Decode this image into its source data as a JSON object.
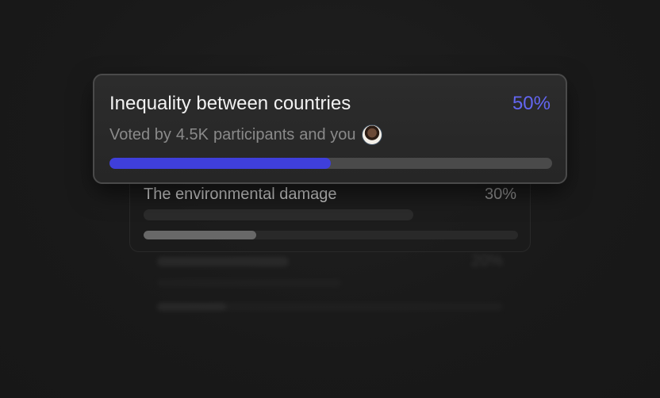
{
  "poll": {
    "options": [
      {
        "title": "Inequality between countries",
        "percent_label": "50%",
        "percent": 50,
        "meta": {
          "voted_by": "Voted by",
          "count": "4.5K",
          "participants": "participants",
          "and_you": "and you"
        },
        "colors": {
          "accent": "#6366f1",
          "fill": "#3f3fdb"
        }
      },
      {
        "title": "The environmental damage",
        "percent_label": "30%",
        "percent": 30
      },
      {
        "percent_label": "20%",
        "percent": 20
      }
    ]
  }
}
